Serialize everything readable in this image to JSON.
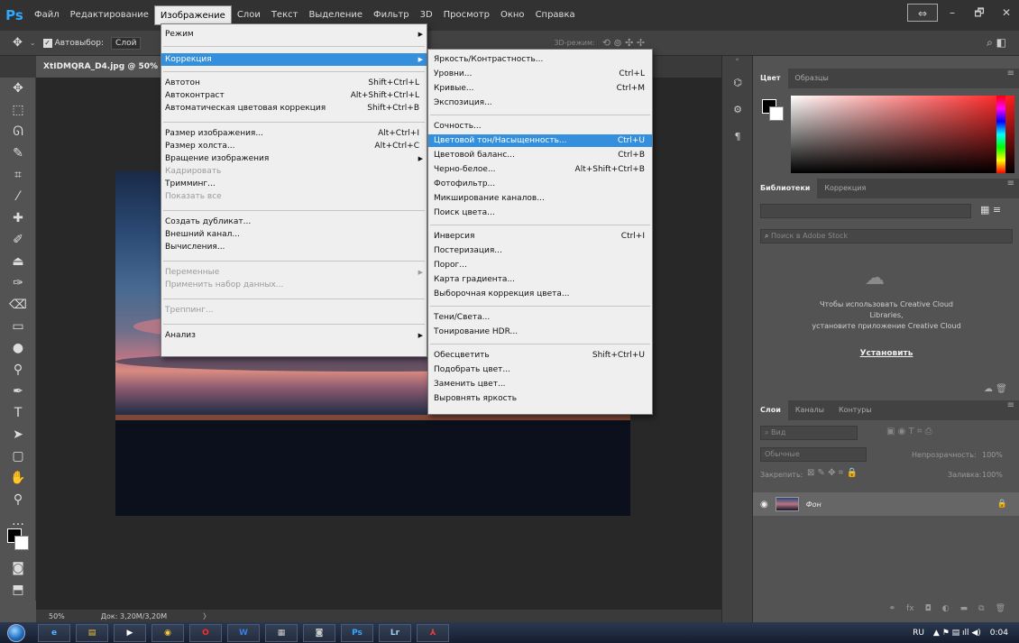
{
  "app": {
    "logo": "Ps"
  },
  "menubar": {
    "items": [
      "Файл",
      "Редактирование",
      "Изображение",
      "Слои",
      "Текст",
      "Выделение",
      "Фильтр",
      "3D",
      "Просмотр",
      "Окно",
      "Справка"
    ],
    "active_index": 2
  },
  "window_controls": {
    "resize": "⇔",
    "minimize": "–",
    "maximize": "🗗",
    "close": "✕"
  },
  "options_bar": {
    "move_icon": "move-icon",
    "autoselect_label": "Автовыбор:",
    "autoselect_value": "Слой",
    "mode3d_label": "3D-режим:"
  },
  "document_tab": {
    "label": "XtIDMQRA_D4.jpg @ 50% ("
  },
  "status_bar": {
    "zoom": "50%",
    "doc_info": "Док: 3,20M/3,20M"
  },
  "image_menu": {
    "items": [
      {
        "label": "Режим",
        "shortcut": "",
        "submenu": true,
        "disabled": false,
        "highlight": false
      },
      {
        "label": "Коррекция",
        "shortcut": "",
        "submenu": true,
        "disabled": false,
        "highlight": true
      },
      {
        "label": "Автотон",
        "shortcut": "Shift+Ctrl+L",
        "submenu": false,
        "disabled": false,
        "highlight": false
      },
      {
        "label": "Автоконтраст",
        "shortcut": "Alt+Shift+Ctrl+L",
        "submenu": false,
        "disabled": false,
        "highlight": false
      },
      {
        "label": "Автоматическая цветовая коррекция",
        "shortcut": "Shift+Ctrl+B",
        "submenu": false,
        "disabled": false,
        "highlight": false
      },
      {
        "label": "Размер изображения...",
        "shortcut": "Alt+Ctrl+I",
        "submenu": false,
        "disabled": false,
        "highlight": false
      },
      {
        "label": "Размер холста...",
        "shortcut": "Alt+Ctrl+C",
        "submenu": false,
        "disabled": false,
        "highlight": false
      },
      {
        "label": "Вращение изображения",
        "shortcut": "",
        "submenu": true,
        "disabled": false,
        "highlight": false
      },
      {
        "label": "Кадрировать",
        "shortcut": "",
        "submenu": false,
        "disabled": true,
        "highlight": false
      },
      {
        "label": "Тримминг...",
        "shortcut": "",
        "submenu": false,
        "disabled": false,
        "highlight": false
      },
      {
        "label": "Показать все",
        "shortcut": "",
        "submenu": false,
        "disabled": true,
        "highlight": false
      },
      {
        "label": "Создать дубликат...",
        "shortcut": "",
        "submenu": false,
        "disabled": false,
        "highlight": false
      },
      {
        "label": "Внешний канал...",
        "shortcut": "",
        "submenu": false,
        "disabled": false,
        "highlight": false
      },
      {
        "label": "Вычисления...",
        "shortcut": "",
        "submenu": false,
        "disabled": false,
        "highlight": false
      },
      {
        "label": "Переменные",
        "shortcut": "",
        "submenu": true,
        "disabled": true,
        "highlight": false
      },
      {
        "label": "Применить набор данных...",
        "shortcut": "",
        "submenu": false,
        "disabled": true,
        "highlight": false
      },
      {
        "label": "Треппинг...",
        "shortcut": "",
        "submenu": false,
        "disabled": true,
        "highlight": false
      },
      {
        "label": "Анализ",
        "shortcut": "",
        "submenu": true,
        "disabled": false,
        "highlight": false
      }
    ]
  },
  "correction_menu": {
    "items": [
      {
        "label": "Яркость/Контрастность...",
        "shortcut": "",
        "highlight": false
      },
      {
        "label": "Уровни...",
        "shortcut": "Ctrl+L",
        "highlight": false
      },
      {
        "label": "Кривые...",
        "shortcut": "Ctrl+M",
        "highlight": false
      },
      {
        "label": "Экспозиция...",
        "shortcut": "",
        "highlight": false
      },
      {
        "label": "Сочность...",
        "shortcut": "",
        "highlight": false
      },
      {
        "label": "Цветовой тон/Насыщенность...",
        "shortcut": "Ctrl+U",
        "highlight": true
      },
      {
        "label": "Цветовой баланс...",
        "shortcut": "Ctrl+B",
        "highlight": false
      },
      {
        "label": "Черно-белое...",
        "shortcut": "Alt+Shift+Ctrl+B",
        "highlight": false
      },
      {
        "label": "Фотофильтр...",
        "shortcut": "",
        "highlight": false
      },
      {
        "label": "Микширование каналов...",
        "shortcut": "",
        "highlight": false
      },
      {
        "label": "Поиск цвета...",
        "shortcut": "",
        "highlight": false
      },
      {
        "label": "Инверсия",
        "shortcut": "Ctrl+I",
        "highlight": false
      },
      {
        "label": "Постеризация...",
        "shortcut": "",
        "highlight": false
      },
      {
        "label": "Порог...",
        "shortcut": "",
        "highlight": false
      },
      {
        "label": "Карта градиента...",
        "shortcut": "",
        "highlight": false
      },
      {
        "label": "Выборочная коррекция цвета...",
        "shortcut": "",
        "highlight": false
      },
      {
        "label": "Тени/Света...",
        "shortcut": "",
        "highlight": false
      },
      {
        "label": "Тонирование HDR...",
        "shortcut": "",
        "highlight": false
      },
      {
        "label": "Обесцветить",
        "shortcut": "Shift+Ctrl+U",
        "highlight": false
      },
      {
        "label": "Подобрать цвет...",
        "shortcut": "",
        "highlight": false
      },
      {
        "label": "Заменить цвет...",
        "shortcut": "",
        "highlight": false
      },
      {
        "label": "Выровнять яркость",
        "shortcut": "",
        "highlight": false
      }
    ]
  },
  "color_panel": {
    "tabs": [
      "Цвет",
      "Образцы"
    ]
  },
  "libraries_panel": {
    "tabs": [
      "Библиотеки",
      "Коррекция"
    ],
    "search_placeholder": "Поиск в Adobe Stock",
    "message_line1": "Чтобы использовать Creative Cloud",
    "message_line2": "Libraries,",
    "message_line3": "установите приложение Creative Cloud",
    "install_label": "Установить"
  },
  "layers_panel": {
    "tabs": [
      "Слои",
      "Каналы",
      "Контуры"
    ],
    "filter_placeholder": "Вид",
    "blend_mode": "Обычные",
    "opacity_label": "Непрозрачность:",
    "opacity_value": "100%",
    "lock_label": "Закрепить:",
    "fill_label": "Заливка:",
    "fill_value": "100%",
    "layer_name": "Фон"
  },
  "taskbar": {
    "lang": "RU",
    "time": "0:04",
    "apps": [
      "ie",
      "folder",
      "media",
      "chrome",
      "opera",
      "W",
      "doc",
      "camera",
      "Ps",
      "Lr",
      "pdf"
    ]
  }
}
